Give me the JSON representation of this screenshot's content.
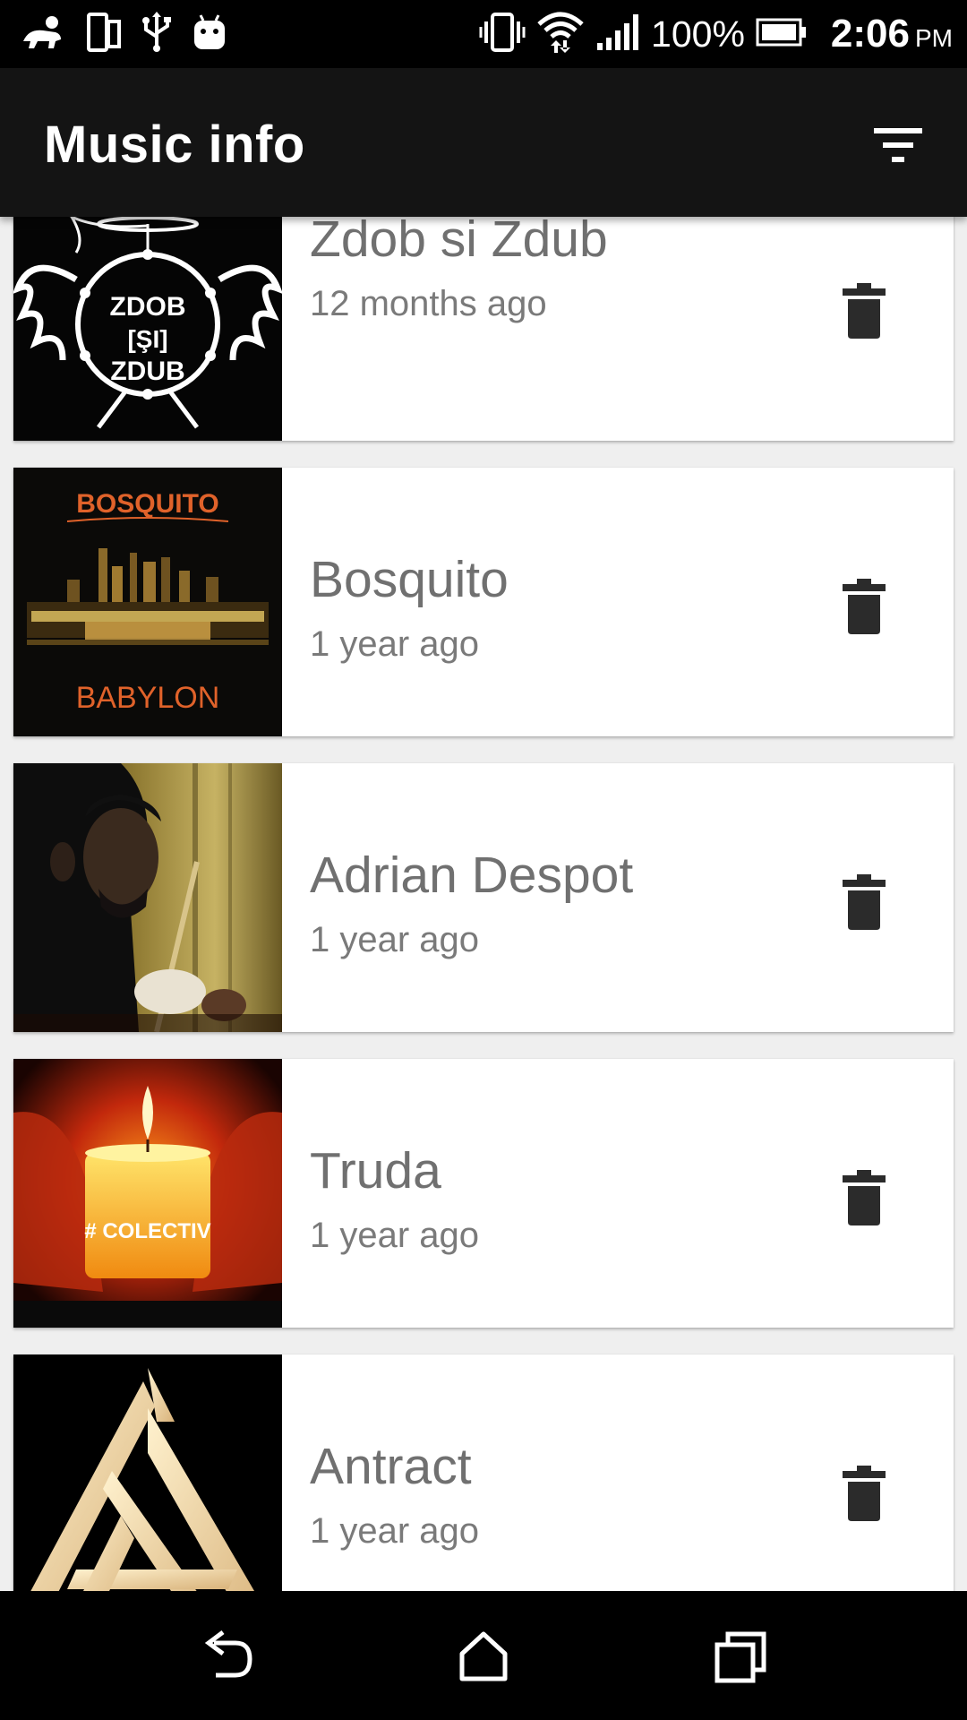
{
  "status_bar": {
    "battery_percent": "100%",
    "time": "2:06",
    "ampm": "PM",
    "icons": [
      "baby-crawl-icon",
      "phone-device-icon",
      "usb-icon",
      "android-icon",
      "vibrate-icon",
      "wifi-icon",
      "signal-icon",
      "battery-icon"
    ]
  },
  "app_bar": {
    "title": "Music info",
    "filter_icon": "filter-icon"
  },
  "items": [
    {
      "title": "Zdob si Zdub",
      "subtitle": "12 months ago",
      "art_text": [
        "ZDOB",
        "[ŞI]",
        "ZDUB"
      ]
    },
    {
      "title": "Bosquito",
      "subtitle": "1 year ago",
      "art_text": [
        "BOSQUITO",
        "BABYLON"
      ]
    },
    {
      "title": "Adrian Despot",
      "subtitle": "1 year ago",
      "art_text": []
    },
    {
      "title": "Truda",
      "subtitle": "1 year ago",
      "art_text": [
        "# COLECTIV"
      ]
    },
    {
      "title": "Antract",
      "subtitle": "1 year ago",
      "art_text": []
    }
  ],
  "nav_bar": {
    "icons": [
      "back-icon",
      "home-icon",
      "recents-icon"
    ]
  },
  "colors": {
    "app_bar": "#141414",
    "background": "#efefef",
    "title_text": "#707070",
    "delete_icon": "#2b2b2b"
  }
}
